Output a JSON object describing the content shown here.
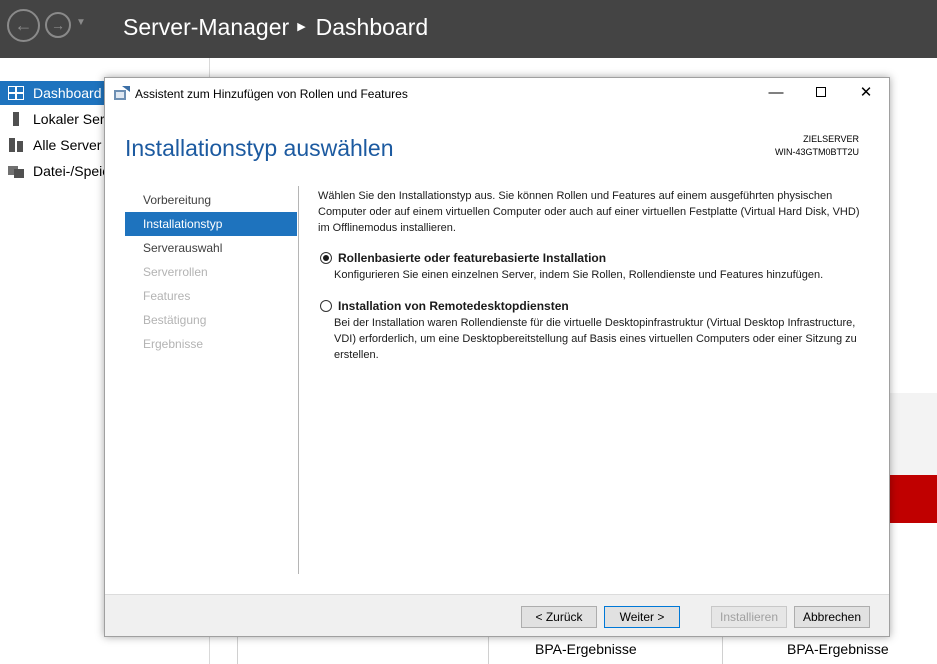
{
  "server_manager": {
    "app_title": "Server-Manager",
    "page": "Dashboard",
    "sidebar": [
      {
        "label": "Dashboard",
        "icon": "dashboard-icon",
        "active": true
      },
      {
        "label": "Lokaler Serv",
        "icon": "local-server-icon",
        "active": false
      },
      {
        "label": "Alle Server",
        "icon": "all-servers-icon",
        "active": false
      },
      {
        "label": "Datei-/Speic",
        "icon": "file-storage-icon",
        "active": false
      }
    ],
    "bpa_labels": [
      "BPA-Ergebnisse",
      "BPA-Ergebnisse"
    ]
  },
  "wizard": {
    "window_title": "Assistent zum Hinzufügen von Rollen und Features",
    "heading": "Installationstyp auswählen",
    "target_label": "ZIELSERVER",
    "target_name": "WIN-43GTM0BTT2U",
    "steps": [
      {
        "label": "Vorbereitung",
        "state": "normal"
      },
      {
        "label": "Installationstyp",
        "state": "active"
      },
      {
        "label": "Serverauswahl",
        "state": "normal"
      },
      {
        "label": "Serverrollen",
        "state": "disabled"
      },
      {
        "label": "Features",
        "state": "disabled"
      },
      {
        "label": "Bestätigung",
        "state": "disabled"
      },
      {
        "label": "Ergebnisse",
        "state": "disabled"
      }
    ],
    "intro": "Wählen Sie den Installationstyp aus. Sie können Rollen und Features auf einem ausgeführten physischen Computer oder auf einem virtuellen Computer oder auch auf einer virtuellen Festplatte (Virtual Hard Disk, VHD) im Offlinemodus installieren.",
    "options": [
      {
        "title": "Rollenbasierte oder featurebasierte Installation",
        "description": "Konfigurieren Sie einen einzelnen Server, indem Sie Rollen, Rollendienste und Features hinzufügen.",
        "selected": true
      },
      {
        "title": "Installation von Remotedesktopdiensten",
        "description": "Bei der Installation waren Rollendienste für die virtuelle Desktopinfrastruktur (Virtual Desktop Infrastructure, VDI) erforderlich, um eine Desktopbereitstellung auf Basis eines virtuellen Computers oder einer Sitzung zu erstellen.",
        "selected": false
      }
    ],
    "buttons": {
      "back": "< Zurück",
      "next": "Weiter >",
      "install": "Installieren",
      "cancel": "Abbrechen"
    }
  },
  "colors": {
    "header_bg": "#444444",
    "accent_blue": "#1e73be",
    "heading_blue": "#1c5aa0",
    "alert_red": "#c00000"
  }
}
